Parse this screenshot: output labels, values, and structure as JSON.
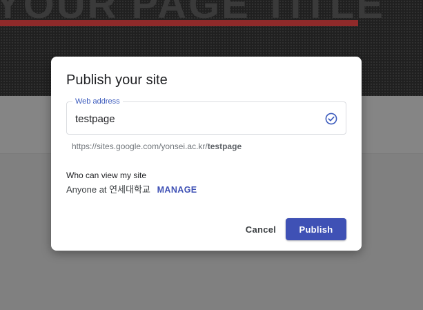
{
  "background": {
    "page_title": "YOUR PAGE TITLE"
  },
  "dialog": {
    "title": "Publish your site",
    "web_address": {
      "label": "Web address",
      "value": "testpage",
      "status_icon": "check-circle-icon"
    },
    "url_preview": {
      "prefix": "https://sites.google.com/yonsei.ac.kr/",
      "path": "testpage"
    },
    "visibility": {
      "heading": "Who can view my site",
      "audience": "Anyone at 연세대학교",
      "manage_label": "MANAGE"
    },
    "buttons": {
      "cancel_label": "Cancel",
      "publish_label": "Publish"
    }
  },
  "colors": {
    "accent": "#3f51b5",
    "label_blue": "#3c5bbd",
    "hero_bar": "#8f2a2a",
    "overlay": "#808080"
  }
}
